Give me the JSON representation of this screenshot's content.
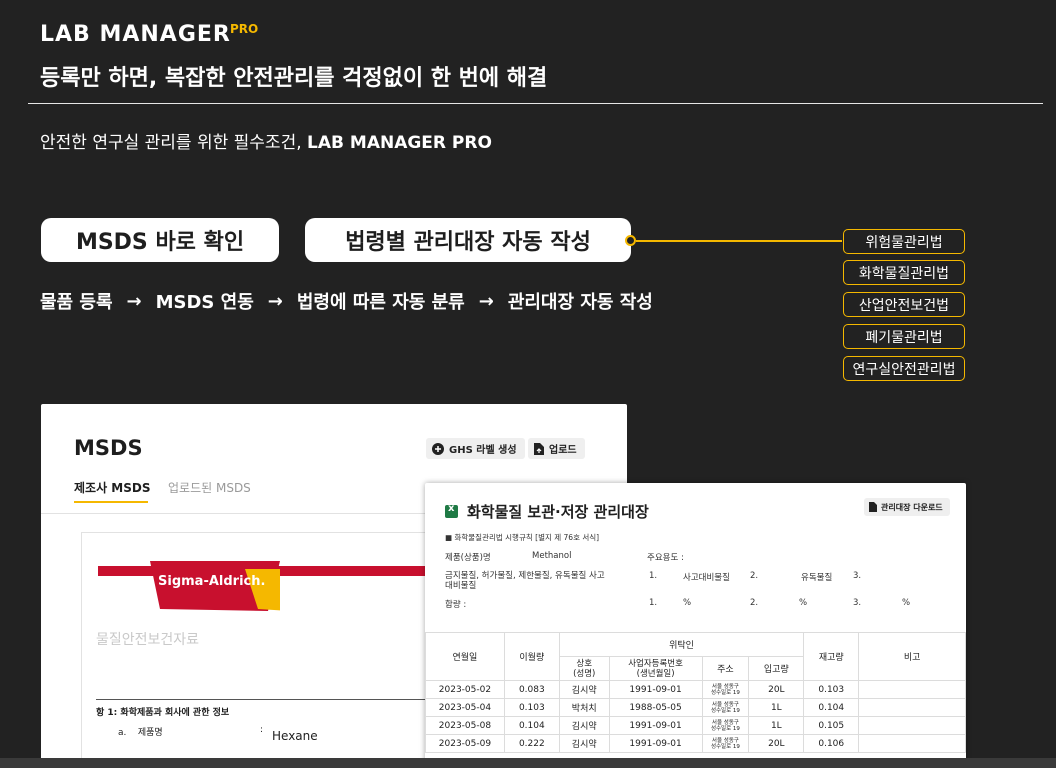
{
  "brand": {
    "logo": "LAB MANAGER",
    "pro": "PRO"
  },
  "headline": "등록만 하면, 복잡한 안전관리를 걱정없이 한 번에 해결",
  "subline": {
    "text": "안전한 연구실 관리를 위한 필수조건,",
    "brand": "LAB MANAGER PRO"
  },
  "pills": {
    "msds": "MSDS 바로 확인",
    "law": "법령별 관리대장 자동 작성"
  },
  "flow": [
    "물품 등록",
    "MSDS 연동",
    "법령에 따른 자동 분류",
    "관리대장 자동 작성"
  ],
  "flow_arrow": "→",
  "laws": [
    "위험물관리법",
    "화학물질관리법",
    "산업안전보건법",
    "폐기물관리법",
    "연구실안전관리법"
  ],
  "accent_color": "#f5b800",
  "msds_card": {
    "title": "MSDS",
    "ghs_button": "GHS 라벨 생성",
    "upload_button": "업로드",
    "tabs": [
      "제조사 MSDS",
      "업로드된 MSDS"
    ],
    "doc": {
      "brand": "Sigma-Aldrich.",
      "title": "물질안전보건자료",
      "section": "항 1: 화학제품과 회사에 관한 정보",
      "row_label": "a.",
      "row_name": "제품명",
      "row_colon": ":",
      "row_value": "Hexane"
    }
  },
  "register_card": {
    "title": "화학물질 보관·저장 관리대장",
    "download_button": "관리대장 다운로드",
    "rule": "■ 화학물질관리법 시행규칙 [별지 제 76호 서식]",
    "product_label": "제품(상품)명",
    "product_value": "Methanol",
    "usage_label": "주요용도 :",
    "category_label": "금지물질, 허가물질, 제한물질, 유독물질 사고대비물질",
    "cat1_num": "1.",
    "cat1_val": "사고대비물질",
    "cat2_num": "2.",
    "cat2_val": "유독물질",
    "cat3_num": "3.",
    "content_label": "함량 :",
    "c1": "1.",
    "c1u": "%",
    "c2": "2.",
    "c2u": "%",
    "c3": "3.",
    "c3u": "%",
    "headers": {
      "date": "연월일",
      "amount": "이월량",
      "consignor": "위탁인",
      "company": "상호\n(성명)",
      "bizno": "사업자등록번호\n(생년월일)",
      "address": "주소",
      "incoming": "입고량",
      "stock": "재고량",
      "note": "비고"
    },
    "rows": [
      {
        "date": "2023-05-02",
        "amount": "0.083",
        "company": "김시약",
        "bizno": "1991-09-01",
        "addr1": "서울 성동구",
        "addr2": "성수일로 19",
        "incoming": "20L",
        "stock": "0.103",
        "note": ""
      },
      {
        "date": "2023-05-04",
        "amount": "0.103",
        "company": "박처치",
        "bizno": "1988-05-05",
        "addr1": "서울 성동구",
        "addr2": "성수일로 19",
        "incoming": "1L",
        "stock": "0.104",
        "note": ""
      },
      {
        "date": "2023-05-08",
        "amount": "0.104",
        "company": "김시약",
        "bizno": "1991-09-01",
        "addr1": "서울 성동구",
        "addr2": "성수일로 19",
        "incoming": "1L",
        "stock": "0.105",
        "note": ""
      },
      {
        "date": "2023-05-09",
        "amount": "0.222",
        "company": "김시약",
        "bizno": "1991-09-01",
        "addr1": "서울 성동구",
        "addr2": "성수일로 19",
        "incoming": "20L",
        "stock": "0.106",
        "note": ""
      }
    ]
  }
}
